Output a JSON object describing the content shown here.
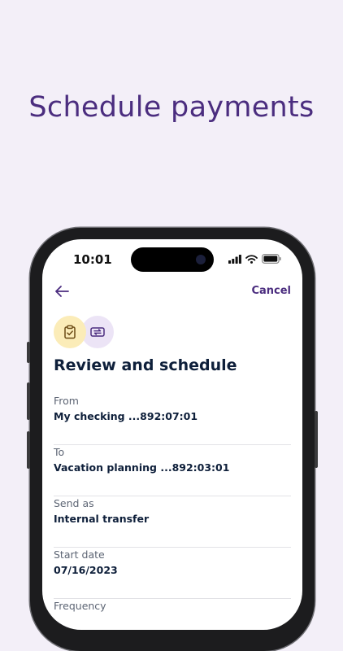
{
  "headline": "Schedule payments",
  "status_bar": {
    "time": "10:01"
  },
  "nav": {
    "cancel_label": "Cancel"
  },
  "page": {
    "title": "Review and schedule"
  },
  "fields": [
    {
      "label": "From",
      "value": "My checking ...892:07:01"
    },
    {
      "label": "To",
      "value": "Vacation planning ...892:03:01"
    },
    {
      "label": "Send as",
      "value": "Internal transfer"
    },
    {
      "label": "Start date",
      "value": "07/16/2023"
    },
    {
      "label": "Frequency",
      "value": ""
    }
  ],
  "icons": {
    "back": "arrow-left-icon",
    "badge_one": "clipboard-check-icon",
    "badge_two": "transfer-icon"
  },
  "colors": {
    "background": "#f3eff8",
    "brand_purple": "#4b2d7f",
    "text_navy": "#0e1f3a",
    "badge_yellow": "#fbecb8",
    "badge_lavender": "#ece4f6"
  }
}
